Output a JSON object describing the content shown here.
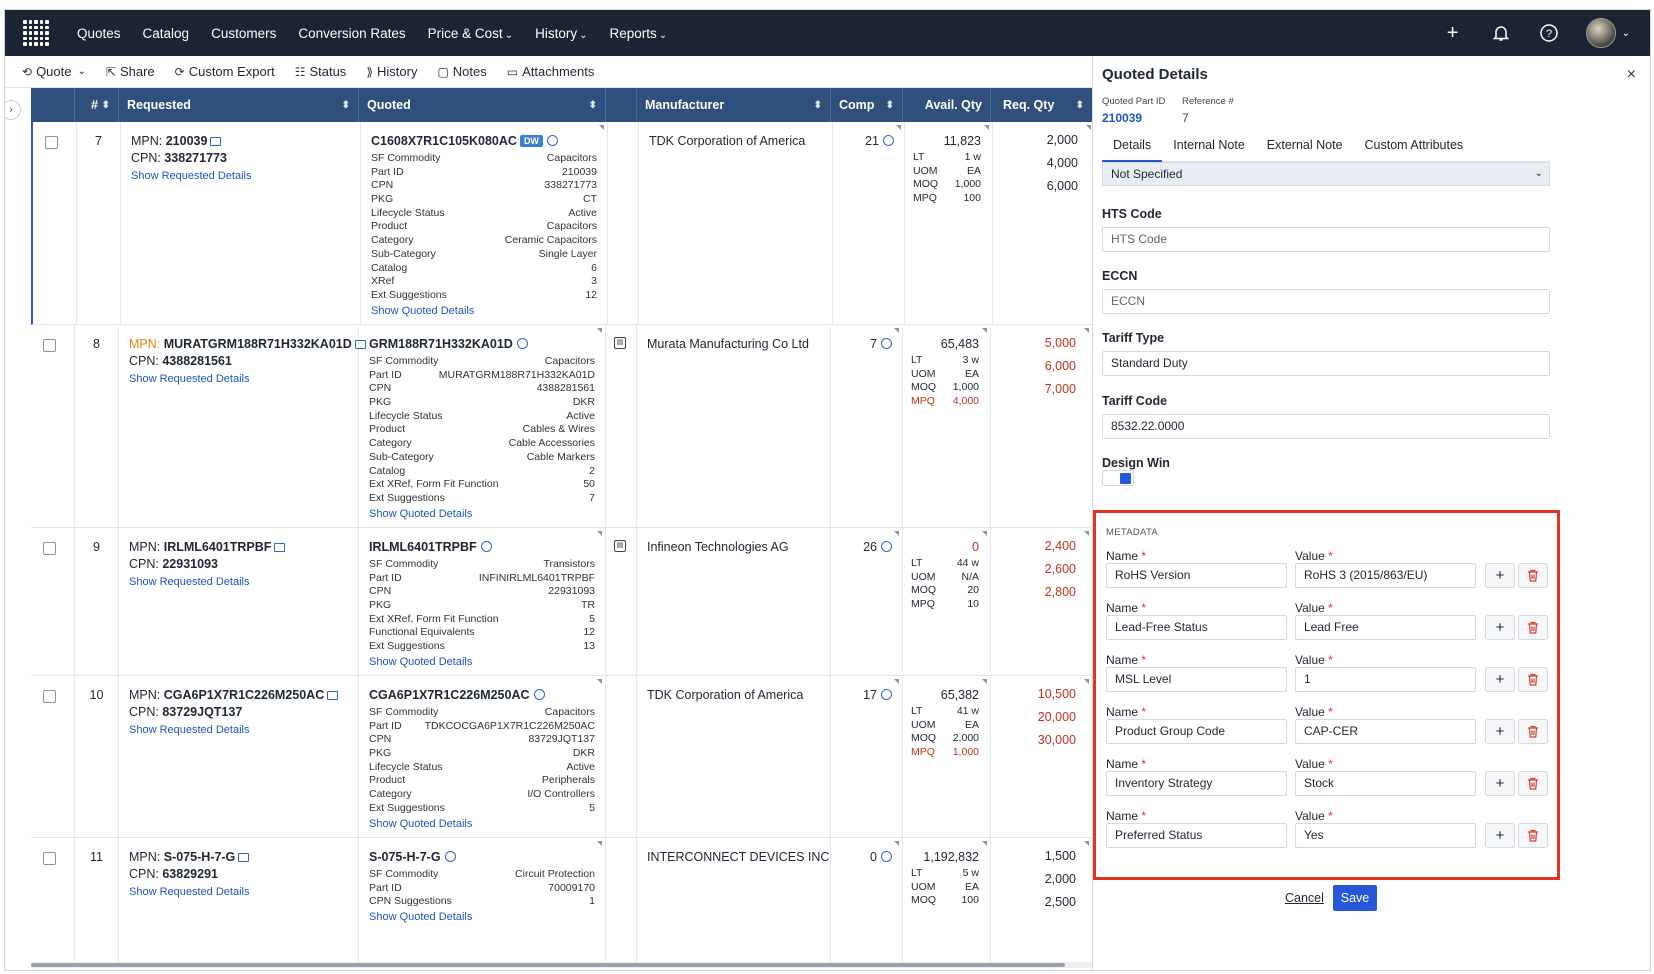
{
  "nav": {
    "links": [
      "Quotes",
      "Catalog",
      "Customers",
      "Conversion Rates",
      "Price & Cost",
      "History",
      "Reports"
    ]
  },
  "toolbar": {
    "quote": "Quote",
    "share": "Share",
    "custom_export": "Custom Export",
    "status": "Status",
    "history": "History",
    "notes": "Notes",
    "attachments": "Attachments"
  },
  "table": {
    "headers": {
      "num": "#",
      "requested": "Requested",
      "quoted": "Quoted",
      "manufacturer": "Manufacturer",
      "comp": "Comp",
      "avail": "Avail. Qty",
      "req": "Req. Qty"
    },
    "show_requested": "Show Requested Details",
    "show_quoted": "Show Quoted Details",
    "mpn_label": "MPN:",
    "cpn_label": "CPN:",
    "rows": [
      {
        "num": "7",
        "mpn": "210039",
        "cpn": "338271773",
        "quoted": "C1608X7R1C105K080AC",
        "badge": "DW",
        "attrs": [
          [
            "SF Commodity",
            "Capacitors"
          ],
          [
            "Part ID",
            "210039"
          ],
          [
            "CPN",
            "338271773"
          ],
          [
            "PKG",
            "CT"
          ],
          [
            "Lifecycle Status",
            "Active"
          ],
          [
            "Product",
            "Capacitors"
          ],
          [
            "Category",
            "Ceramic Capacitors"
          ],
          [
            "Sub-Category",
            "Single Layer"
          ],
          [
            "Catalog",
            "6"
          ],
          [
            "XRef",
            "3"
          ],
          [
            "Ext Suggestions",
            "12"
          ]
        ],
        "manufacturer": "TDK Corporation of America",
        "comp": "21",
        "avail": "11,823",
        "lt": "1 w",
        "uom": "EA",
        "moq": "1,000",
        "mpq": "100",
        "req": [
          "2,000",
          "4,000",
          "6,000"
        ]
      },
      {
        "num": "8",
        "mpn": "MURATGRM188R71H332KA01D",
        "cpn": "4388281561",
        "quoted": "GRM188R71H332KA01D",
        "attrs": [
          [
            "SF Commodity",
            "Capacitors"
          ],
          [
            "Part ID",
            "MURATGRM188R71H332KA01D"
          ],
          [
            "CPN",
            "4388281561"
          ],
          [
            "PKG",
            "DKR"
          ],
          [
            "Lifecycle Status",
            "Active"
          ],
          [
            "Product",
            "Cables & Wires"
          ],
          [
            "Category",
            "Cable Accessories"
          ],
          [
            "Sub-Category",
            "Cable Markers"
          ],
          [
            "Catalog",
            "2"
          ],
          [
            "Ext XRef, Form Fit Function",
            "50"
          ],
          [
            "Ext Suggestions",
            "7"
          ]
        ],
        "manufacturer": "Murata Manufacturing Co Ltd",
        "comp": "7",
        "avail": "65,483",
        "lt": "3 w",
        "uom": "EA",
        "moq": "1,000",
        "mpq": "4,000",
        "req": [
          "5,000",
          "6,000",
          "7,000"
        ]
      },
      {
        "num": "9",
        "mpn": "IRLML6401TRPBF",
        "cpn": "22931093",
        "quoted": "IRLML6401TRPBF",
        "attrs": [
          [
            "SF Commodity",
            "Transistors"
          ],
          [
            "Part ID",
            "INFINIRLML6401TRPBF"
          ],
          [
            "CPN",
            "22931093"
          ],
          [
            "PKG",
            "TR"
          ],
          [
            "Ext XRef, Form Fit Function",
            "5"
          ],
          [
            "Functional Equivalents",
            "12"
          ],
          [
            "Ext Suggestions",
            "13"
          ]
        ],
        "manufacturer": "Infineon Technologies AG",
        "comp": "26",
        "avail": "0",
        "lt": "44 w",
        "uom": "N/A",
        "moq": "20",
        "mpq": "10",
        "req": [
          "2,400",
          "2,600",
          "2,800"
        ]
      },
      {
        "num": "10",
        "mpn": "CGA6P1X7R1C226M250AC",
        "cpn": "83729JQT137",
        "quoted": "CGA6P1X7R1C226M250AC",
        "attrs": [
          [
            "SF Commodity",
            "Capacitors"
          ],
          [
            "Part ID",
            "TDKCOCGA6P1X7R1C226M250AC"
          ],
          [
            "CPN",
            "83729JQT137"
          ],
          [
            "PKG",
            "DKR"
          ],
          [
            "Lifecycle Status",
            "Active"
          ],
          [
            "Product",
            "Peripherals"
          ],
          [
            "Category",
            "I/O Controllers"
          ],
          [
            "Ext Suggestions",
            "5"
          ]
        ],
        "manufacturer": "TDK Corporation of America",
        "comp": "17",
        "avail": "65,382",
        "lt": "41 w",
        "uom": "EA",
        "moq": "2,000",
        "mpq": "1,000",
        "req": [
          "10,500",
          "20,000",
          "30,000"
        ]
      },
      {
        "num": "11",
        "mpn": "S-075-H-7-G",
        "cpn": "63829291",
        "quoted": "S-075-H-7-G",
        "attrs": [
          [
            "SF Commodity",
            "Circuit Protection"
          ],
          [
            "Part ID",
            "70009170"
          ],
          [
            "CPN Suggestions",
            "1"
          ]
        ],
        "manufacturer": "INTERCONNECT DEVICES INC",
        "comp": "0",
        "avail": "1,192,832",
        "lt": "5 w",
        "uom": "EA",
        "moq": "100",
        "req": [
          "1,500",
          "2,000",
          "2,500"
        ]
      }
    ]
  },
  "avail_labels": {
    "lt": "LT",
    "uom": "UOM",
    "moq": "MOQ",
    "mpq": "MPQ"
  },
  "panel": {
    "title": "Quoted Details",
    "close": "×",
    "quoted_part_id_label": "Quoted Part ID",
    "quoted_part_id": "210039",
    "reference_label": "Reference #",
    "reference": "7",
    "tabs": [
      "Details",
      "Internal Note",
      "External Note",
      "Custom Attributes"
    ],
    "select_value": "Not Specified",
    "hts_label": "HTS Code",
    "hts_placeholder": "HTS Code",
    "eccn_label": "ECCN",
    "eccn_placeholder": "ECCN",
    "tariff_type_label": "Tariff Type",
    "tariff_type": "Standard Duty",
    "tariff_code_label": "Tariff Code",
    "tariff_code": "8532.22.0000",
    "design_win_label": "Design Win",
    "design_win": true,
    "metadata_title": "METADATA",
    "name_label": "Name",
    "value_label": "Value",
    "metadata": [
      {
        "name": "RoHS Version",
        "value": "RoHS 3 (2015/863/EU)"
      },
      {
        "name": "Lead-Free Status",
        "value": "Lead Free"
      },
      {
        "name": "MSL Level",
        "value": "1"
      },
      {
        "name": "Product Group Code",
        "value": "CAP-CER"
      },
      {
        "name": "Inventory Strategy",
        "value": "Stock"
      },
      {
        "name": "Preferred Status",
        "value": "Yes"
      }
    ],
    "cancel": "Cancel",
    "save": "Save"
  },
  "colors": {
    "nav_bg": "#1b2433",
    "header_bg": "#2f4f7d",
    "accent": "#2557d6",
    "highlight": "#e53322",
    "red": "#c53020",
    "orange": "#e8830c"
  }
}
